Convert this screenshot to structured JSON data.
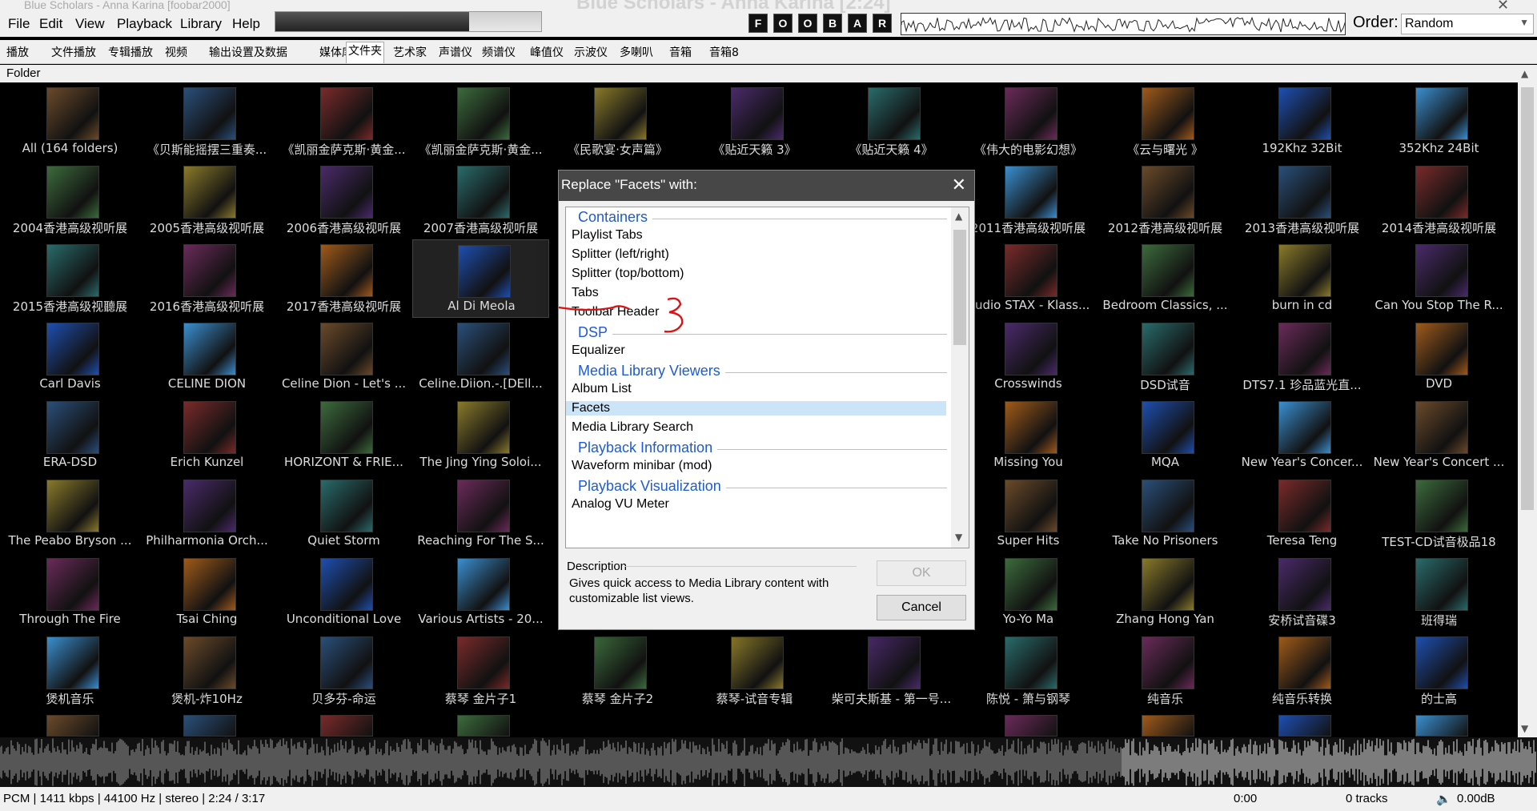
{
  "window": {
    "title": "Blue Scholars - Anna Karina [2:24]",
    "caption": "Blue Scholars - Anna Karina [foobar2000]"
  },
  "menu": [
    "File",
    "Edit",
    "View",
    "Playback",
    "Library",
    "Help"
  ],
  "transport_buttons": [
    "F",
    "O",
    "O",
    "B",
    "A",
    "R"
  ],
  "seek_progress": 0.73,
  "order": {
    "label": "Order:",
    "value": "Random"
  },
  "tabs": [
    "播放",
    "文件播放",
    "专辑播放",
    "视频",
    "输出设置及数据",
    "媒体库",
    "文件夹",
    "艺术家",
    "声谱仪",
    "频谱仪",
    "峰值仪",
    "示波仪",
    "多喇叭",
    "音箱",
    "音箱8"
  ],
  "active_tab": "文件夹",
  "folder_header": "Folder",
  "grid": [
    [
      "All (164 folders)",
      "《贝斯能摇摆三重奏...",
      "《凯丽金萨克斯·黄金...",
      "《凯丽金萨克斯·黄金...",
      "《民歌宴·女声篇》",
      "《贴近天籁 3》",
      "《贴近天籁 4》",
      "《伟大的电影幻想》",
      "《云与曙光 》",
      "192Khz 32Bit",
      "352Khz 24Bit"
    ],
    [
      "2004香港高级视听展",
      "2005香港高级视听展",
      "2006香港高级视听展",
      "2007香港高级视听展",
      "",
      "",
      "",
      "2011香港高级视听展",
      "2012香港高级视听展",
      "2013香港高级视听展",
      "2014香港高级视听展"
    ],
    [
      "2015香港高级视聽展",
      "2016香港高级视听展",
      "2017香港高级视听展",
      "Al Di Meola",
      "",
      "",
      "",
      "Audio STAX - Klass...",
      "Bedroom Classics, ...",
      "burn in cd",
      "Can You Stop The R..."
    ],
    [
      "Carl Davis",
      "CELINE DION",
      "Celine Dion - Let's ...",
      "Celine.Diion.-.[DEll...",
      "",
      "",
      "",
      "Crosswinds",
      "DSD试音",
      "DTS7.1 珍品蓝光直...",
      "DVD"
    ],
    [
      "ERA-DSD",
      "Erich Kunzel",
      "HORIZONT & FRIE...",
      "The Jing Ying Soloi...",
      "",
      "",
      "",
      "Missing You",
      "MQA",
      "New Year's Concer...",
      "New Year's Concert ..."
    ],
    [
      "The Peabo Bryson ...",
      "Philharmonia Orch...",
      "Quiet Storm",
      "Reaching For The S...",
      "",
      "",
      "",
      "Super Hits",
      "Take No Prisoners",
      "Teresa Teng",
      "TEST-CD试音极品18"
    ],
    [
      "Through The Fire",
      "Tsai Ching",
      "Unconditional Love",
      "Various Artists - 20...",
      "",
      "",
      "",
      "Yo-Yo Ma",
      "Zhang Hong Yan",
      "安桥试音碟3",
      "班得瑞"
    ],
    [
      "煲机音乐",
      "煲机-炸10Hz",
      "贝多芬-命运",
      "蔡琴 金片子1",
      "蔡琴 金片子2",
      "蔡琴-试音专辑",
      "柴可夫斯基 - 第一号...",
      "陈悦 - 箫与钢琴",
      "纯音乐",
      "纯音乐转换",
      "的士高"
    ]
  ],
  "selected_cell": "Al Di Meola",
  "status": {
    "format": "PCM | 1411 kbps | 44100 Hz | stereo | 2:24 / 3:17",
    "position": "0:00",
    "tracks": "0 tracks",
    "volume": "0.00dB"
  },
  "dialog": {
    "title": "Replace \"Facets\" with:",
    "groups": [
      {
        "name": "Containers",
        "items": [
          "Playlist Tabs",
          "Splitter (left/right)",
          "Splitter (top/bottom)",
          "Tabs",
          "Toolbar Header"
        ]
      },
      {
        "name": "DSP",
        "items": [
          "Equalizer"
        ]
      },
      {
        "name": "Media Library Viewers",
        "items": [
          "Album List",
          "Facets",
          "Media Library Search"
        ]
      },
      {
        "name": "Playback Information",
        "items": [
          "Waveform minibar (mod)"
        ]
      },
      {
        "name": "Playback Visualization",
        "items": [
          "Analog VU Meter"
        ]
      }
    ],
    "selected_item": "Facets",
    "description_label": "Description",
    "description": "Gives quick access to Media Library content with customizable list views.",
    "ok": "OK",
    "cancel": "Cancel"
  },
  "annotation_mark": "3",
  "colors": {
    "accent": "#1f5bd1",
    "selection": "#cce4f7",
    "dialog_title": "#474747"
  }
}
